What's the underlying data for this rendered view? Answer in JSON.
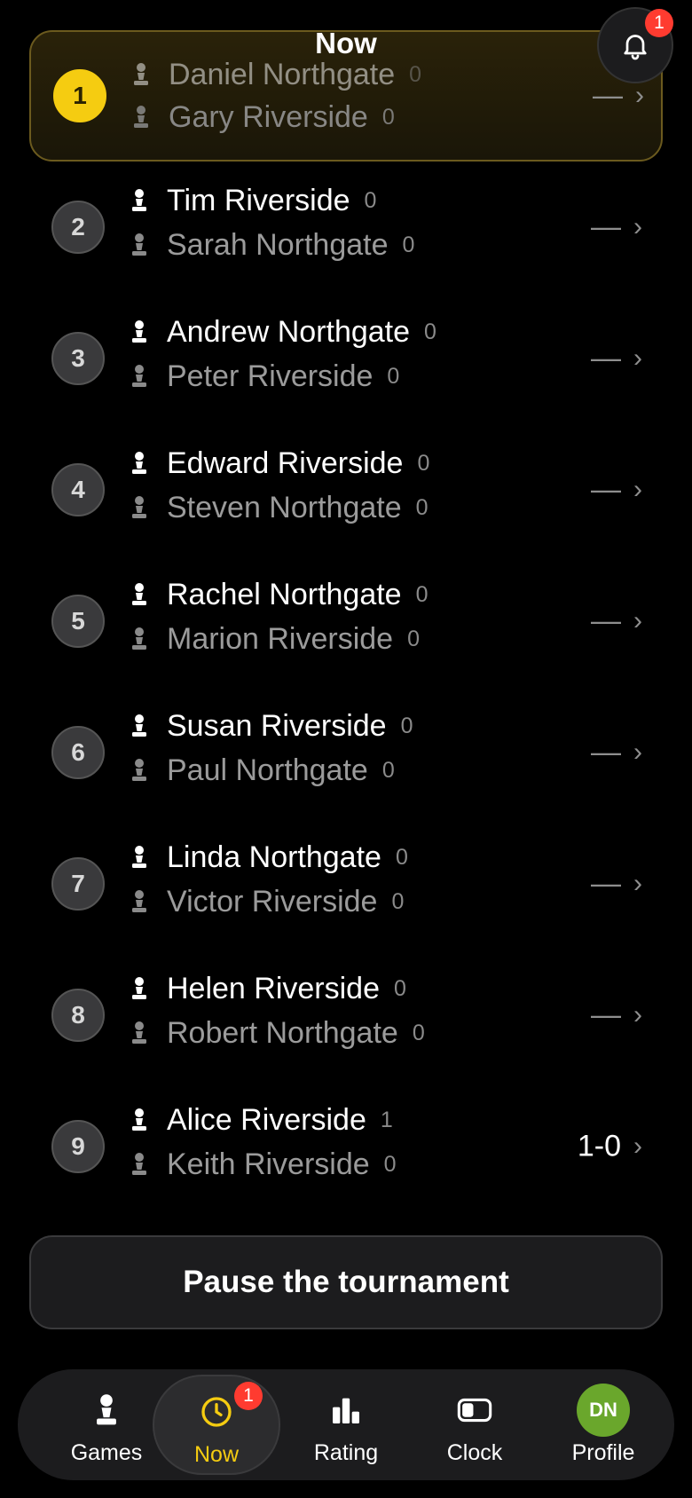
{
  "header": {
    "title": "Now",
    "notification_count": "1"
  },
  "pairings": [
    {
      "board": "1",
      "white": {
        "name": "Daniel Northgate",
        "score": "0"
      },
      "black": {
        "name": "Gary Riverside",
        "score": "0"
      },
      "result": "—"
    },
    {
      "board": "2",
      "white": {
        "name": "Tim Riverside",
        "score": "0"
      },
      "black": {
        "name": "Sarah Northgate",
        "score": "0"
      },
      "result": "—"
    },
    {
      "board": "3",
      "white": {
        "name": "Andrew Northgate",
        "score": "0"
      },
      "black": {
        "name": "Peter Riverside",
        "score": "0"
      },
      "result": "—"
    },
    {
      "board": "4",
      "white": {
        "name": "Edward Riverside",
        "score": "0"
      },
      "black": {
        "name": "Steven Northgate",
        "score": "0"
      },
      "result": "—"
    },
    {
      "board": "5",
      "white": {
        "name": "Rachel Northgate",
        "score": "0"
      },
      "black": {
        "name": "Marion Riverside",
        "score": "0"
      },
      "result": "—"
    },
    {
      "board": "6",
      "white": {
        "name": "Susan Riverside",
        "score": "0"
      },
      "black": {
        "name": "Paul Northgate",
        "score": "0"
      },
      "result": "—"
    },
    {
      "board": "7",
      "white": {
        "name": "Linda Northgate",
        "score": "0"
      },
      "black": {
        "name": "Victor Riverside",
        "score": "0"
      },
      "result": "—"
    },
    {
      "board": "8",
      "white": {
        "name": "Helen Riverside",
        "score": "0"
      },
      "black": {
        "name": "Robert Northgate",
        "score": "0"
      },
      "result": "—"
    },
    {
      "board": "9",
      "white": {
        "name": "Alice Riverside",
        "score": "1"
      },
      "black": {
        "name": "Keith Riverside",
        "score": "0"
      },
      "result": "1-0"
    }
  ],
  "chevron": "›",
  "pause_button": "Pause the tournament",
  "tabs": [
    {
      "label": "Games",
      "icon": "pawn-icon"
    },
    {
      "label": "Now",
      "icon": "clock-icon",
      "badge": "1"
    },
    {
      "label": "Rating",
      "icon": "bar-chart-icon"
    },
    {
      "label": "Clock",
      "icon": "chess-clock-icon"
    },
    {
      "label": "Profile",
      "icon": "avatar",
      "initials": "DN"
    }
  ],
  "colors": {
    "accent": "#f5cc11",
    "badge": "#ff3b30",
    "avatar": "#6aa72c"
  }
}
